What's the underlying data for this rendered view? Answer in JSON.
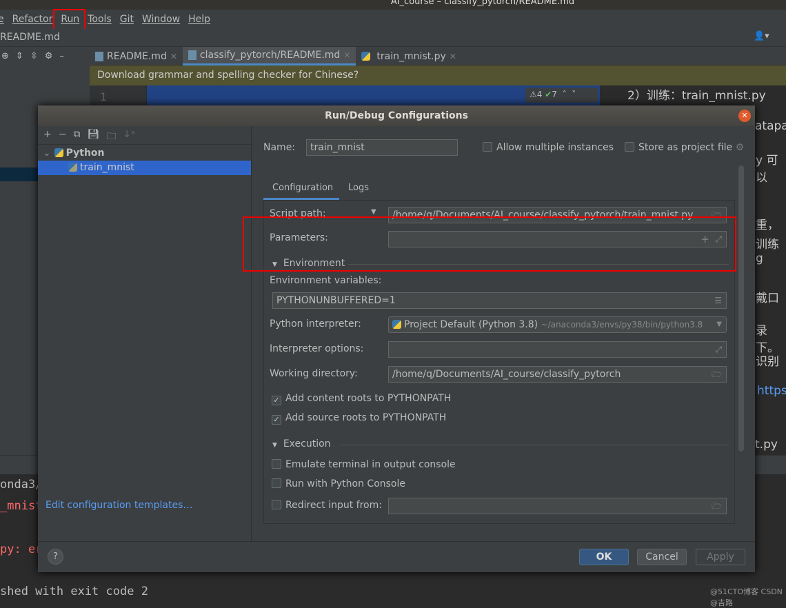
{
  "window_title": "AI_course – classify_pytorch/README.md",
  "menu": [
    "e",
    "Refactor",
    "Run",
    "Tools",
    "Git",
    "Window",
    "Help"
  ],
  "nav_file": "README.md",
  "tabs": [
    {
      "label": "README.md"
    },
    {
      "label": "classify_pytorch/README.md",
      "active": true
    },
    {
      "label": "train_mnist.py"
    }
  ],
  "banner": "Download grammar and spelling checker for Chinese?",
  "gutter_line": "1",
  "inspection": {
    "warnings": "4",
    "ok": "7"
  },
  "editor_fragments": [
    "2）训练：train_mnist.py",
    "atapat",
    "y 可以",
    "重，",
    "训练 g",
    "戴口",
    "录下。",
    "识别",
    "https",
    "t.py"
  ],
  "console_lines": [
    "onda3/",
    "_mnist",
    "py: er",
    "shed with exit code 2"
  ],
  "dialog": {
    "title": "Run/Debug Configurations",
    "tree": {
      "group": "Python",
      "item": "train_mnist"
    },
    "edit_templates": "Edit configuration templates…",
    "name_label": "Name:",
    "name_value": "train_mnist",
    "allow_multiple": "Allow multiple instances",
    "allow_multiple_checked": false,
    "store_project": "Store as project file",
    "store_project_checked": false,
    "tabs": [
      "Configuration",
      "Logs"
    ],
    "script_path_label": "Script path:",
    "script_path": "/home/q/Documents/AI_course/classify_pytorch/train_mnist.py",
    "parameters_label": "Parameters:",
    "parameters": "",
    "environment_section": "Environment",
    "env_vars_label": "Environment variables:",
    "env_vars": "PYTHONUNBUFFERED=1",
    "interpreter_label": "Python interpreter:",
    "interpreter": "Project Default (Python 3.8)",
    "interpreter_path": "~/anaconda3/envs/py38/bin/python3.8",
    "interp_options_label": "Interpreter options:",
    "interp_options": "",
    "workdir_label": "Working directory:",
    "workdir": "/home/q/Documents/AI_course/classify_pytorch",
    "add_content_roots": "Add content roots to PYTHONPATH",
    "add_content_roots_checked": true,
    "add_source_roots": "Add source roots to PYTHONPATH",
    "add_source_roots_checked": true,
    "execution_section": "Execution",
    "emulate_terminal": "Emulate terminal in output console",
    "emulate_terminal_checked": false,
    "python_console": "Run with Python Console",
    "python_console_checked": false,
    "redirect_input": "Redirect input from:",
    "redirect_input_checked": false,
    "redirect_input_value": "",
    "ok": "OK",
    "cancel": "Cancel",
    "apply": "Apply",
    "help": "?"
  },
  "watermark": "@51CTO博客 CSDN @吉路",
  "colors": {
    "accent": "#4a88c7",
    "selection": "#2f65ca",
    "link": "#589df6",
    "annotation": "#ff0000"
  }
}
